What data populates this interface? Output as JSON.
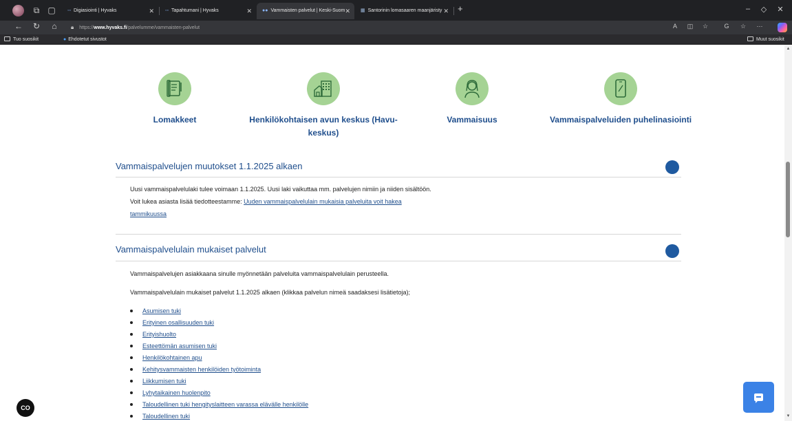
{
  "browser": {
    "tabs": [
      {
        "label": "Digiasiointi | Hyvaks",
        "favicon": "hyvaks-favicon"
      },
      {
        "label": "Tapahtumani | Hyvaks",
        "favicon": "hyvaks-favicon"
      },
      {
        "label": "Vammaisten palvelut | Keski-Suom",
        "favicon": "hyvaks-favicon"
      },
      {
        "label": "Santorinin lomasaaren maanjäristy",
        "favicon": "news-favicon"
      }
    ],
    "url_prefix": "https://",
    "url_domain": "www.hyvaks.fi",
    "url_path": "/palvelumme/vammaisten-palvelut",
    "favorites": {
      "left1": "Tuo suosikit",
      "left2": "Ehdotetut sivustot",
      "right": "Muut suosikit"
    }
  },
  "categories": [
    {
      "label": "Lomakkeet",
      "icon": "form-icon"
    },
    {
      "label": "Henkilökohtaisen avun keskus (Havu-keskus)",
      "icon": "building-icon"
    },
    {
      "label": "Vammaisuus",
      "icon": "person-icon"
    },
    {
      "label": "Vammaispalveluiden puhelinasiointi",
      "icon": "phone-icon"
    }
  ],
  "section1": {
    "title": "Vammaispalvelujen muutokset 1.1.2025 alkaen",
    "text": "Uusi vammaispalvelulaki tulee voimaan 1.1.2025. Uusi laki vaikuttaa mm. palvelujen nimiin ja niiden sisältöön. Voit lukea asiasta lisää tiedotteestamme:",
    "link": "Uuden vammaispalvelulain mukaisia palveluita voit hakea tammikuussa"
  },
  "section2": {
    "title": "Vammaispalvelulain mukaiset palvelut",
    "intro": "Vammaispalvelujen asiakkaana sinulle myönnetään palveluita vammaispalvelulain perusteella.",
    "intro2": "Vammaispalvelulain mukaiset palvelut 1.1.2025 alkaen (klikkaa palvelun nimeä saadaksesi lisätietoja);",
    "items": [
      "Asumisen tuki",
      "Erityinen osallisuuden tuki",
      "Erityishuolto",
      "Esteettömän asumisen tuki",
      "Henkilökohtainen apu",
      "Kehitysvammaisten henkilöiden työtoiminta",
      "Liikkumisen tuki",
      "Lyhytaikainen huolenpito",
      "Taloudellinen tuki hengityslaitteen varassa elävälle henkilölle",
      "Taloudellinen tuki"
    ]
  },
  "widgets": {
    "cc_label": "CO"
  },
  "colors": {
    "accent": "#1f4e8c",
    "icon_circle": "#a5d394",
    "toggle": "#1f5aa0",
    "chat_button": "#3b82e6"
  }
}
